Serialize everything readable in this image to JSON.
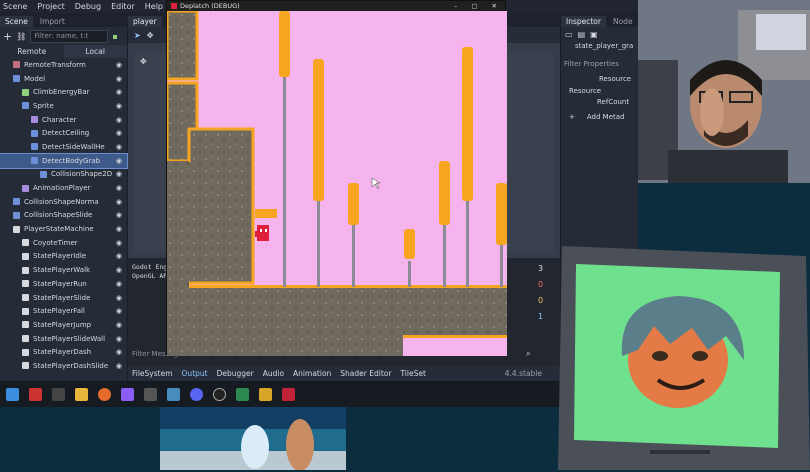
{
  "menubar": {
    "items": [
      "Scene",
      "Project",
      "Debug",
      "Editor",
      "Help"
    ],
    "right_label": "Comp"
  },
  "scene_dock": {
    "tabs": [
      "Scene",
      "Import"
    ],
    "filter_placeholder": "Filter: name, t:t",
    "remote_label": "Remote",
    "local_label": "Local",
    "tree": [
      {
        "label": "RemoteTransform",
        "indent": 1,
        "color": "#c4727f"
      },
      {
        "label": "Model",
        "indent": 1,
        "color": "#6e90d8"
      },
      {
        "label": "ClimbEnergyBar",
        "indent": 2,
        "color": "#8fd17a"
      },
      {
        "label": "Sprite",
        "indent": 2,
        "color": "#6e90d8"
      },
      {
        "label": "Character",
        "indent": 3,
        "color": "#a78bdc"
      },
      {
        "label": "DetectCeiling",
        "indent": 3,
        "color": "#6e90d8"
      },
      {
        "label": "DetectSideWallHe",
        "indent": 3,
        "color": "#6e90d8"
      },
      {
        "label": "DetectBodyGrab",
        "indent": 3,
        "color": "#6e90d8",
        "selected": true
      },
      {
        "label": "CollisionShape2D",
        "indent": 4,
        "color": "#6e90d8"
      },
      {
        "label": "AnimationPlayer",
        "indent": 2,
        "color": "#a78bdc"
      },
      {
        "label": "CollisionShapeNorma",
        "indent": 1,
        "color": "#6e90d8"
      },
      {
        "label": "CollisionShapeSlide",
        "indent": 1,
        "color": "#6e90d8"
      },
      {
        "label": "PlayerStateMachine",
        "indent": 1,
        "color": "#d6d9de"
      },
      {
        "label": "CoyoteTimer",
        "indent": 2,
        "color": "#d6d9de"
      },
      {
        "label": "StatePlayerIdle",
        "indent": 2,
        "color": "#d6d9de"
      },
      {
        "label": "StatePlayerWalk",
        "indent": 2,
        "color": "#d6d9de"
      },
      {
        "label": "StatePlayerRun",
        "indent": 2,
        "color": "#d6d9de"
      },
      {
        "label": "StatePlayerSlide",
        "indent": 2,
        "color": "#d6d9de"
      },
      {
        "label": "StatePlayerFall",
        "indent": 2,
        "color": "#d6d9de"
      },
      {
        "label": "StatePlayerJump",
        "indent": 2,
        "color": "#d6d9de"
      },
      {
        "label": "StatePlayerSlideWall",
        "indent": 2,
        "color": "#d6d9de"
      },
      {
        "label": "StatePlayerDash",
        "indent": 2,
        "color": "#d6d9de"
      },
      {
        "label": "StatePlayerDashSlide",
        "indent": 2,
        "color": "#d6d9de"
      }
    ]
  },
  "viewport": {
    "tab_label": "player"
  },
  "output": {
    "log_line1": "Godot Eng",
    "log_line2": "OpenGL AP",
    "filter_placeholder": "Filter Messages",
    "tabs": [
      "FileSystem",
      "Output",
      "Debugger",
      "Audio",
      "Animation",
      "Shader Editor",
      "TileSet"
    ],
    "active_tab": "Output",
    "version": "4.4.stable",
    "counts": [
      "3",
      "0",
      "0",
      "1"
    ]
  },
  "inspector": {
    "tabs": [
      "Inspector",
      "Node"
    ],
    "path": "state_player_gra",
    "filter_label": "Filter Properties",
    "resource_label": "Resource",
    "resource_section": "Resource",
    "refcount_label": "RefCount",
    "add_meta_label": "Add Metad"
  },
  "game_window": {
    "title": "Deplatch (DEBUG)"
  },
  "colors": {
    "sky": "#f6b4ee",
    "pillar": "#f7a520",
    "ground": "#6f6a5d",
    "player": "#e0213b",
    "selection": "#3d5a8a"
  }
}
